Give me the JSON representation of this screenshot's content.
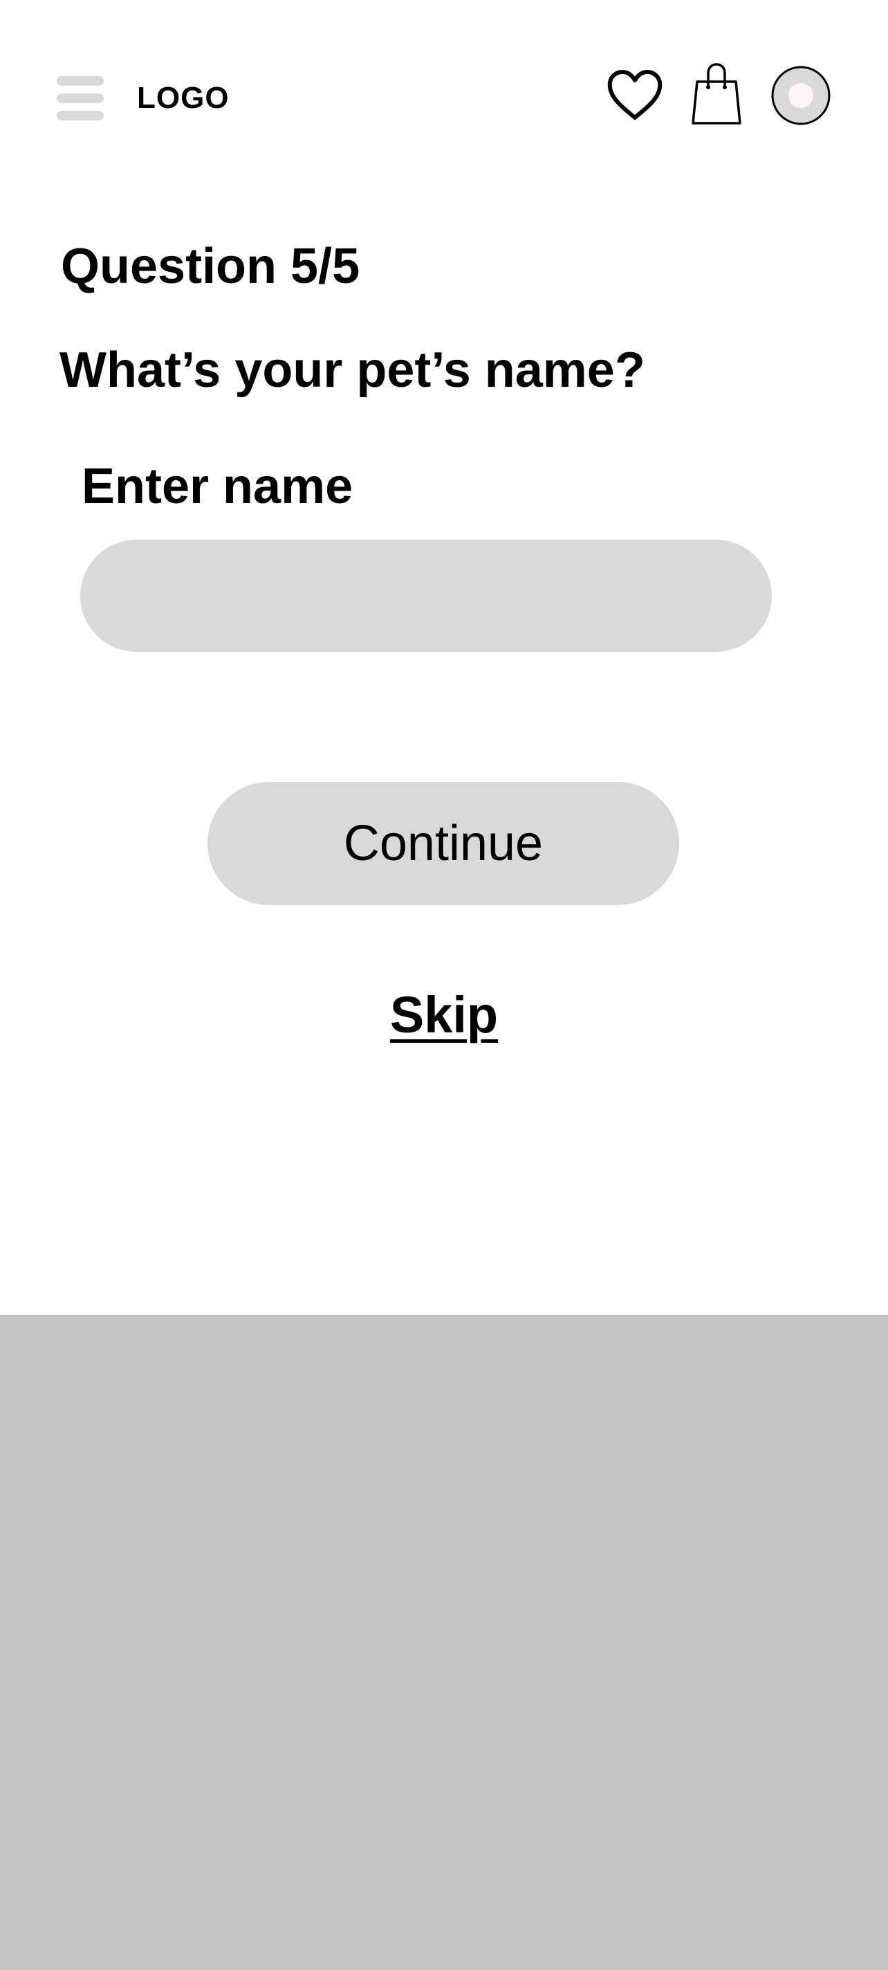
{
  "header": {
    "logo": "LOGO",
    "icons": {
      "menu": "hamburger-menu-icon",
      "favorites": "heart-icon",
      "cart": "shopping-bag-icon",
      "account": "avatar-icon"
    }
  },
  "quiz": {
    "progress": "Question 5/5",
    "current_question": 5,
    "total_questions": 5,
    "question": "What’s your pet’s name?",
    "field_label": "Enter name",
    "input_value": "",
    "input_placeholder": "",
    "continue_label": "Continue",
    "skip_label": "Skip"
  },
  "colors": {
    "background": "#ffffff",
    "text": "#000000",
    "control_fill": "#d9d9d9",
    "menu_bars": "#d9d9d9",
    "avatar_fill": "#d9d9d9",
    "avatar_inner": "#fdf5f5",
    "bottom_panel": "#c4c4c4"
  }
}
